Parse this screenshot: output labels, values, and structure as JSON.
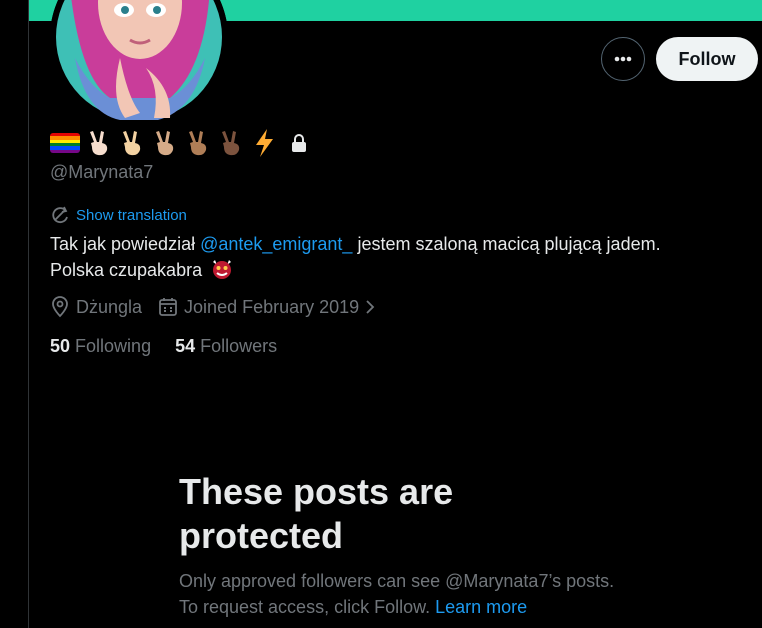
{
  "colors": {
    "banner": "#1fd1a1",
    "link": "#1d9bf0",
    "muted": "#71767b",
    "text": "#e7e9ea"
  },
  "profile": {
    "display_name_icons": [
      "rainbow-flag-icon",
      "victory-hand-light-icon",
      "victory-hand-medium-light-icon",
      "victory-hand-medium-icon",
      "victory-hand-medium-dark-icon",
      "victory-hand-dark-icon",
      "lightning-icon"
    ],
    "protected_icon": "lock-icon",
    "handle": "@Marynata7",
    "show_translation": "Show translation",
    "bio": {
      "before": "Tak jak powiedział ",
      "mention": "@antek_emigrant_",
      "after": " jestem szaloną macicą plującą jadem.",
      "line2": "Polska czupakabra",
      "ogre_icon": "ogre-icon"
    },
    "location": "Dżungla",
    "joined": "Joined February 2019",
    "following_count": "50",
    "following_label": "Following",
    "followers_count": "54",
    "followers_label": "Followers"
  },
  "actions": {
    "follow_label": "Follow",
    "more_icon": "more-icon"
  },
  "protected": {
    "title": "These posts are protected",
    "description": "Only approved followers can see @Marynata7’s posts. To request access, click Follow.",
    "learn_more": "Learn more"
  }
}
